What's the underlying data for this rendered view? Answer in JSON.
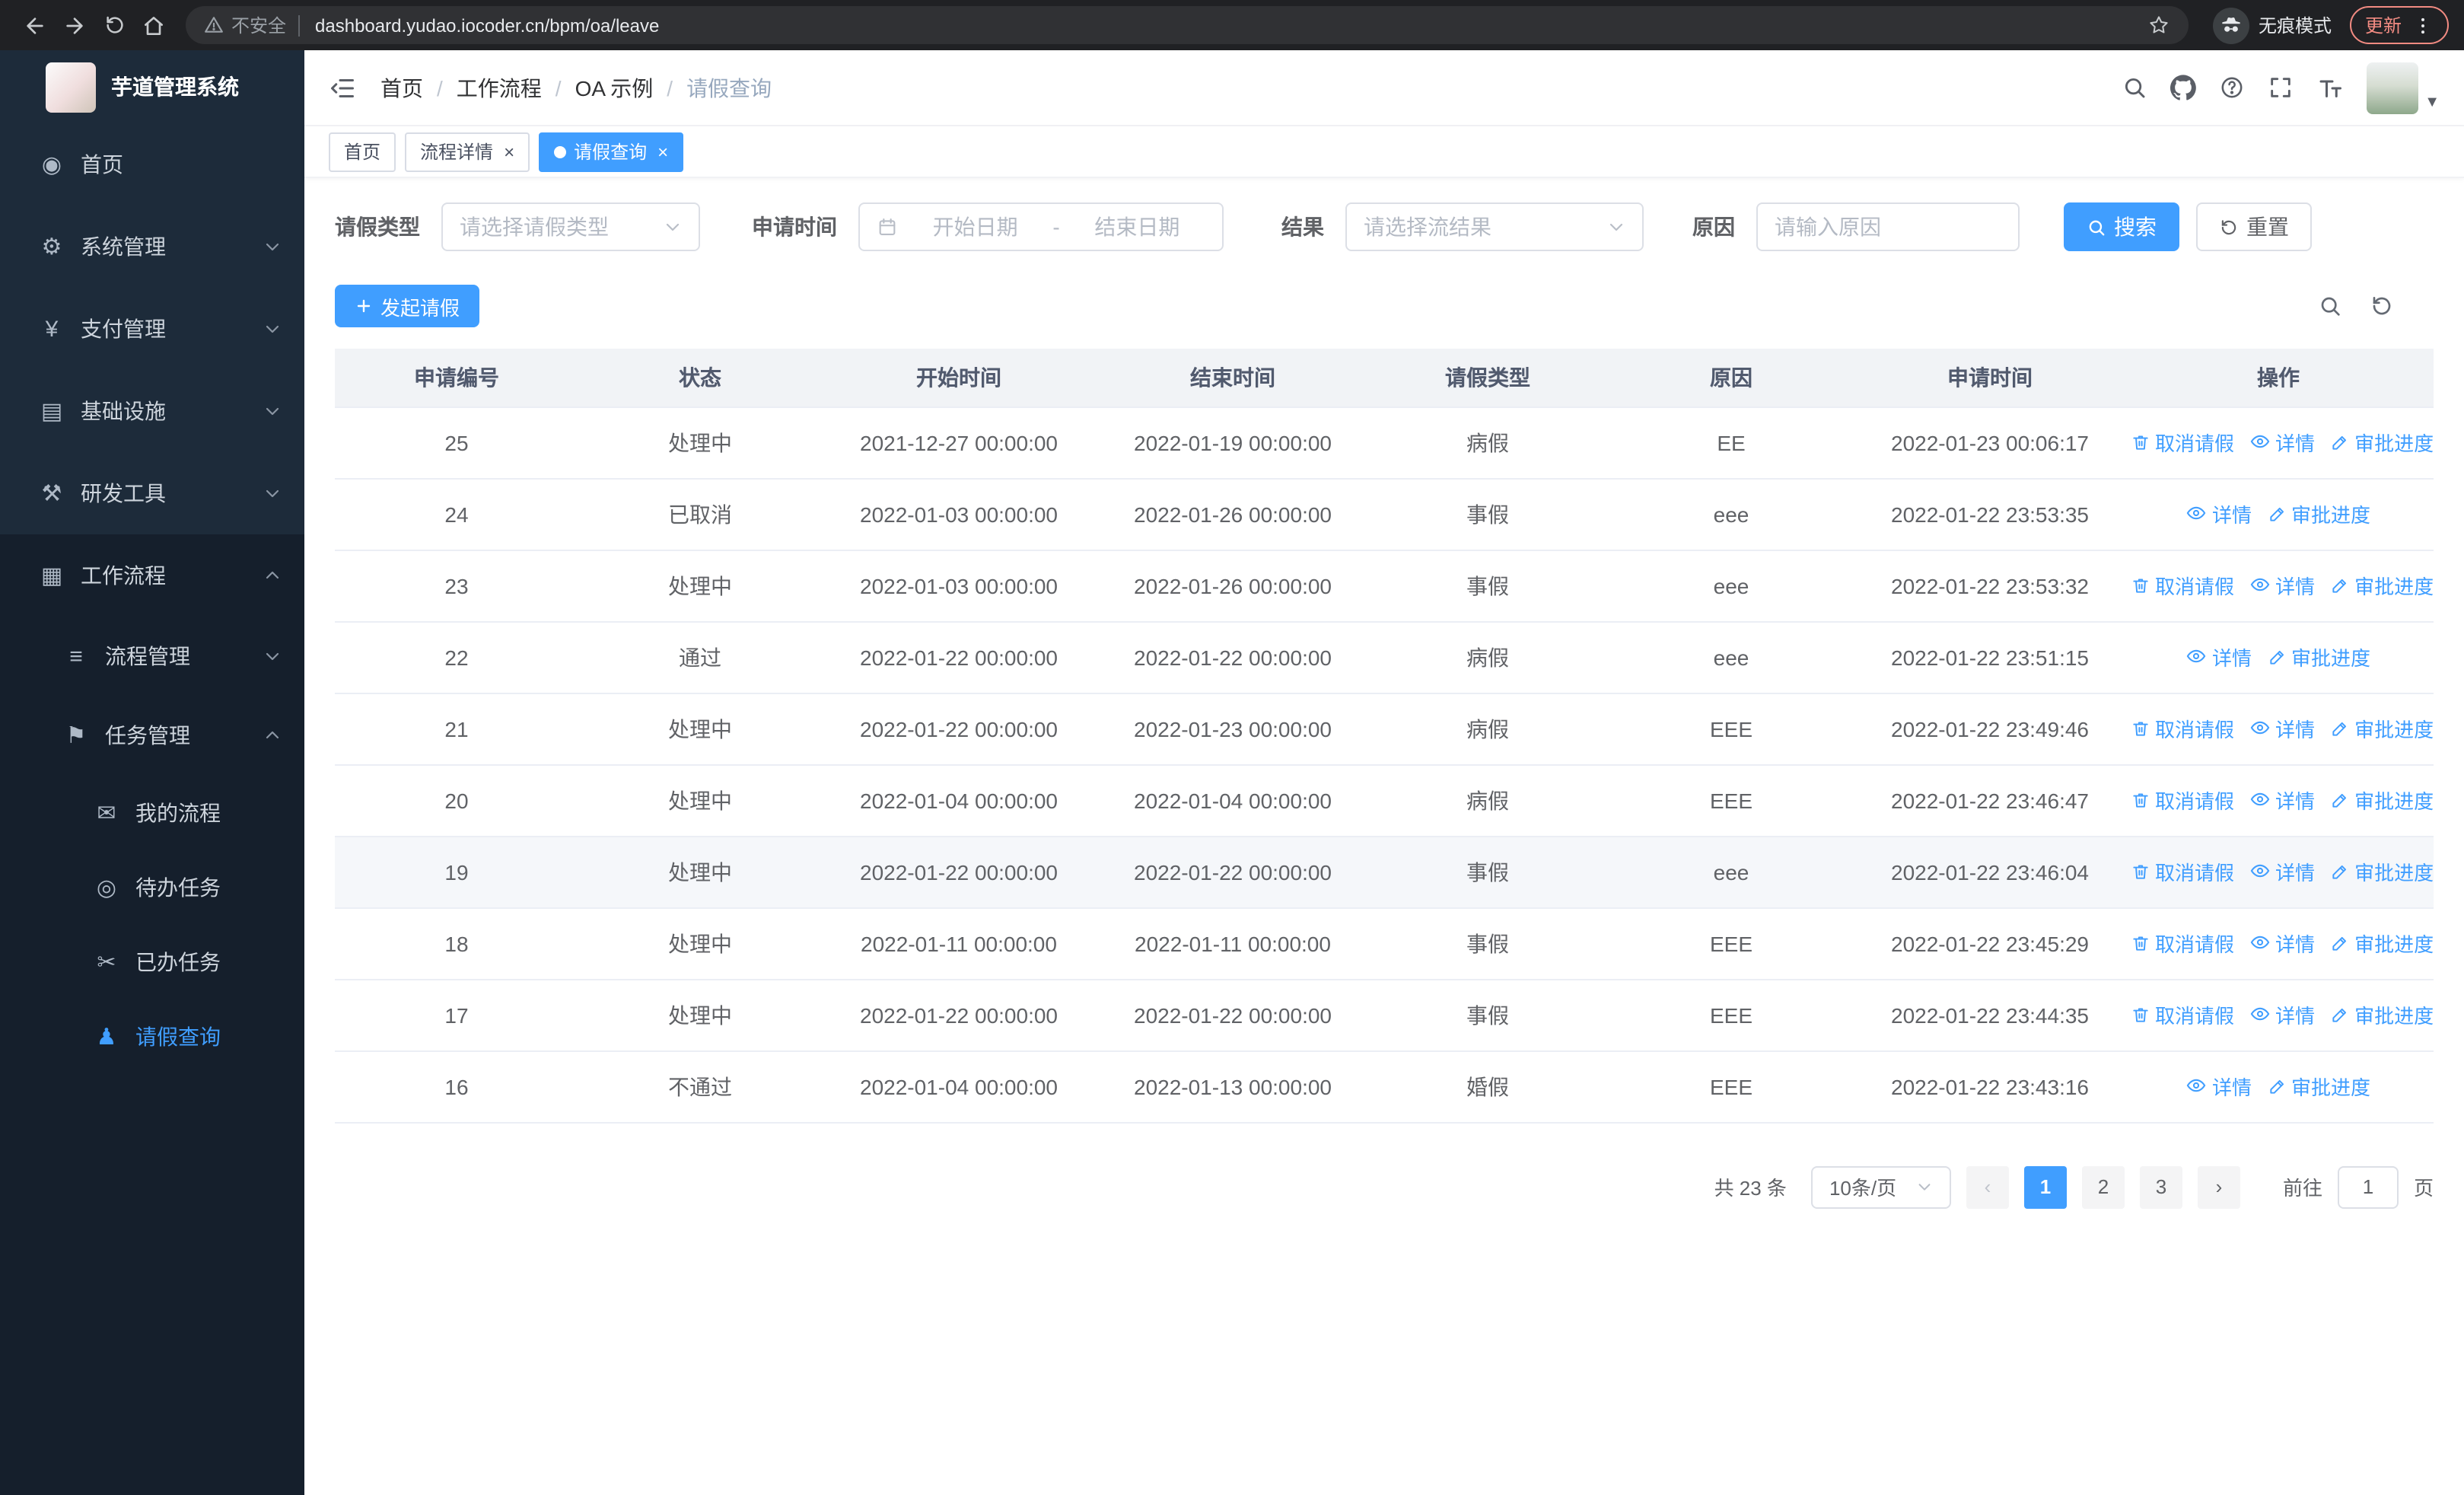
{
  "browser": {
    "security_label": "不安全",
    "url": "dashboard.yudao.iocoder.cn/bpm/oa/leave",
    "incognito_label": "无痕模式",
    "update_label": "更新"
  },
  "sidebar": {
    "app_title": "芋道管理系统",
    "items": [
      {
        "label": "首页",
        "icon": "home-icon",
        "level": 1,
        "chevron": null,
        "active": false
      },
      {
        "label": "系统管理",
        "icon": "gear-icon",
        "level": 1,
        "chevron": "down",
        "active": false
      },
      {
        "label": "支付管理",
        "icon": "payment-icon",
        "level": 1,
        "chevron": "down",
        "active": false
      },
      {
        "label": "基础设施",
        "icon": "infrastructure-icon",
        "level": 1,
        "chevron": "down",
        "active": false
      },
      {
        "label": "研发工具",
        "icon": "devtools-icon",
        "level": 1,
        "chevron": "down",
        "active": false
      },
      {
        "label": "工作流程",
        "icon": "workflow-icon",
        "level": 1,
        "chevron": "up",
        "section": true,
        "active": false
      },
      {
        "label": "流程管理",
        "icon": "process-icon",
        "level": 2,
        "chevron": "down",
        "active": false
      },
      {
        "label": "任务管理",
        "icon": "task-icon",
        "level": 2,
        "chevron": "up",
        "active": false
      },
      {
        "label": "我的流程",
        "icon": "my-process-icon",
        "level": 3,
        "chevron": null,
        "active": false
      },
      {
        "label": "待办任务",
        "icon": "todo-icon",
        "level": 3,
        "chevron": null,
        "active": false
      },
      {
        "label": "已办任务",
        "icon": "done-icon",
        "level": 3,
        "chevron": null,
        "active": false
      },
      {
        "label": "请假查询",
        "icon": "leave-icon",
        "level": 3,
        "chevron": null,
        "active": true
      }
    ]
  },
  "header": {
    "breadcrumb": [
      "首页",
      "工作流程",
      "OA 示例",
      "请假查询"
    ]
  },
  "tabs": [
    {
      "label": "首页",
      "closable": false,
      "active": false
    },
    {
      "label": "流程详情",
      "closable": true,
      "active": false
    },
    {
      "label": "请假查询",
      "closable": true,
      "active": true
    }
  ],
  "filters": {
    "leave_type": {
      "label": "请假类型",
      "placeholder": "请选择请假类型"
    },
    "apply_time": {
      "label": "申请时间",
      "start_placeholder": "开始日期",
      "separator": "-",
      "end_placeholder": "结束日期"
    },
    "result": {
      "label": "结果",
      "placeholder": "请选择流结果"
    },
    "reason": {
      "label": "原因",
      "placeholder": "请输入原因"
    },
    "search_label": "搜索",
    "reset_label": "重置"
  },
  "toolbar": {
    "create_label": "发起请假"
  },
  "table": {
    "columns": [
      "申请编号",
      "状态",
      "开始时间",
      "结束时间",
      "请假类型",
      "原因",
      "申请时间",
      "操作"
    ],
    "actions": {
      "cancel": "取消请假",
      "detail": "详情",
      "progress": "审批进度"
    },
    "rows": [
      {
        "id": "25",
        "status": "处理中",
        "start": "2021-12-27 00:00:00",
        "end": "2022-01-19 00:00:00",
        "type": "病假",
        "reason": "EE",
        "applied": "2022-01-23 00:06:17",
        "cancellable": true,
        "highlighted": false
      },
      {
        "id": "24",
        "status": "已取消",
        "start": "2022-01-03 00:00:00",
        "end": "2022-01-26 00:00:00",
        "type": "事假",
        "reason": "eee",
        "applied": "2022-01-22 23:53:35",
        "cancellable": false,
        "highlighted": false
      },
      {
        "id": "23",
        "status": "处理中",
        "start": "2022-01-03 00:00:00",
        "end": "2022-01-26 00:00:00",
        "type": "事假",
        "reason": "eee",
        "applied": "2022-01-22 23:53:32",
        "cancellable": true,
        "highlighted": false
      },
      {
        "id": "22",
        "status": "通过",
        "start": "2022-01-22 00:00:00",
        "end": "2022-01-22 00:00:00",
        "type": "病假",
        "reason": "eee",
        "applied": "2022-01-22 23:51:15",
        "cancellable": false,
        "highlighted": false
      },
      {
        "id": "21",
        "status": "处理中",
        "start": "2022-01-22 00:00:00",
        "end": "2022-01-23 00:00:00",
        "type": "病假",
        "reason": "EEE",
        "applied": "2022-01-22 23:49:46",
        "cancellable": true,
        "highlighted": false
      },
      {
        "id": "20",
        "status": "处理中",
        "start": "2022-01-04 00:00:00",
        "end": "2022-01-04 00:00:00",
        "type": "病假",
        "reason": "EEE",
        "applied": "2022-01-22 23:46:47",
        "cancellable": true,
        "highlighted": false
      },
      {
        "id": "19",
        "status": "处理中",
        "start": "2022-01-22 00:00:00",
        "end": "2022-01-22 00:00:00",
        "type": "事假",
        "reason": "eee",
        "applied": "2022-01-22 23:46:04",
        "cancellable": true,
        "highlighted": true
      },
      {
        "id": "18",
        "status": "处理中",
        "start": "2022-01-11 00:00:00",
        "end": "2022-01-11 00:00:00",
        "type": "事假",
        "reason": "EEE",
        "applied": "2022-01-22 23:45:29",
        "cancellable": true,
        "highlighted": false
      },
      {
        "id": "17",
        "status": "处理中",
        "start": "2022-01-22 00:00:00",
        "end": "2022-01-22 00:00:00",
        "type": "事假",
        "reason": "EEE",
        "applied": "2022-01-22 23:44:35",
        "cancellable": true,
        "highlighted": false
      },
      {
        "id": "16",
        "status": "不通过",
        "start": "2022-01-04 00:00:00",
        "end": "2022-01-13 00:00:00",
        "type": "婚假",
        "reason": "EEE",
        "applied": "2022-01-22 23:43:16",
        "cancellable": false,
        "highlighted": false
      }
    ]
  },
  "pagination": {
    "total_label": "共 23 条",
    "page_size": "10条/页",
    "pages": [
      "1",
      "2",
      "3"
    ],
    "active_page": "1",
    "goto_label": "前往",
    "goto_value": "1",
    "page_label": "页"
  }
}
